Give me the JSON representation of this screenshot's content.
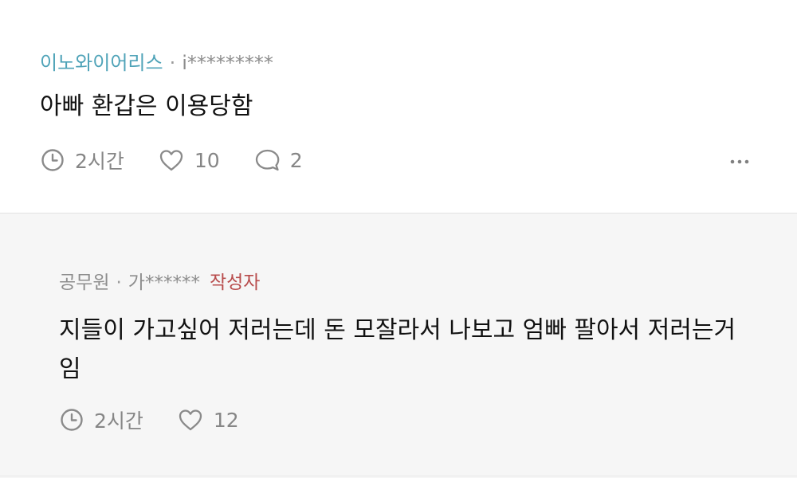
{
  "comment": {
    "nickname": "이노와이어리스",
    "separator": "·",
    "user_id": "i*********",
    "text": "아빠 환갑은 이용당함",
    "time": "2시간",
    "likes": "10",
    "replies": "2",
    "icons": {
      "time": "clock-icon",
      "like": "heart-icon",
      "reply": "speech-bubble-icon",
      "more": "more-dots-icon"
    }
  },
  "reply": {
    "nickname": "공무원",
    "separator": "·",
    "user_id": "가******",
    "author_badge": "작성자",
    "text": "지들이 가고싶어 저러는데 돈 모잘라서 나보고 엄빠 팔아서 저러는거임",
    "time": "2시간",
    "likes": "12",
    "icons": {
      "time": "clock-icon",
      "like": "heart-icon"
    }
  },
  "colors": {
    "nickname_accent": "#4fa3b8",
    "author_badge": "#b84c4c",
    "muted_text": "#868686",
    "reply_background": "#f6f6f6"
  }
}
